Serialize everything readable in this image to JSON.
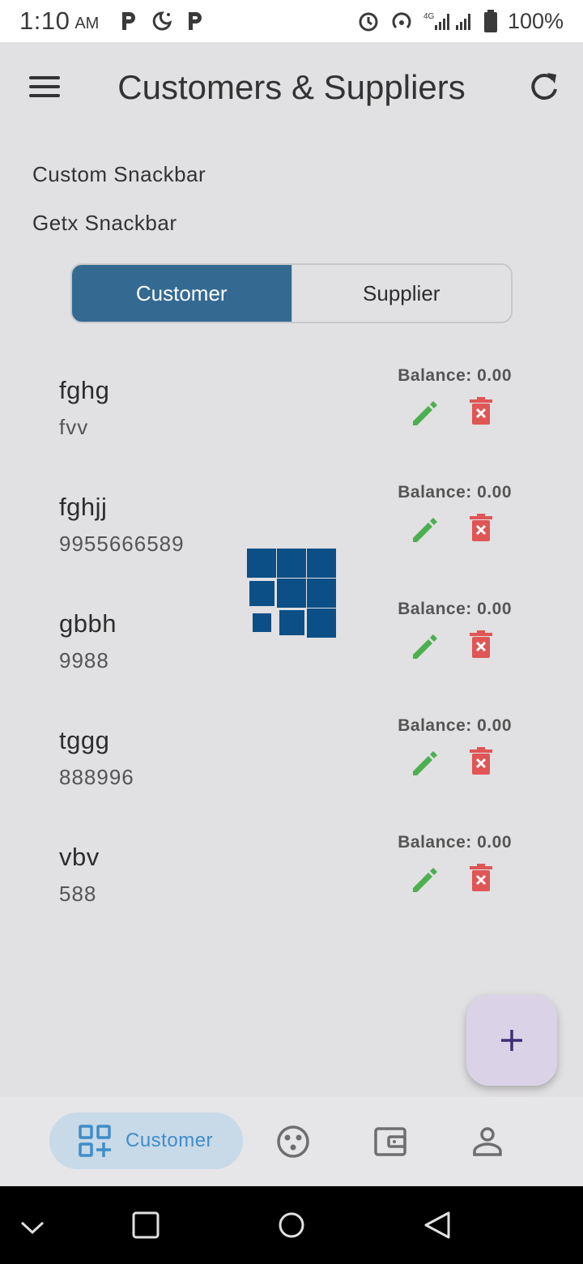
{
  "status_bar": {
    "time": "1:10",
    "ampm": "AM",
    "battery": "100%",
    "network": "4G",
    "icons": [
      "parking-icon",
      "moon-icon",
      "parking-icon",
      "alarm-icon",
      "hotspot-icon",
      "signal-icon",
      "battery-icon"
    ]
  },
  "app_bar": {
    "title": "Customers & Suppliers",
    "menu_icon": "menu-icon",
    "refresh_icon": "refresh-icon"
  },
  "links": {
    "custom_snackbar": "Custom Snackbar",
    "getx_snackbar": "Getx Snackbar"
  },
  "segments": {
    "customer": "Customer",
    "supplier": "Supplier",
    "selected": "Customer"
  },
  "customers": [
    {
      "name": "fghg",
      "sub": "fvv",
      "balance": "Balance: 0.00"
    },
    {
      "name": "fghjj",
      "sub": "9955666589",
      "balance": "Balance: 0.00"
    },
    {
      "name": "gbbh",
      "sub": "9988",
      "balance": "Balance: 0.00"
    },
    {
      "name": "tggg",
      "sub": "888996",
      "balance": "Balance: 0.00"
    },
    {
      "name": "vbv",
      "sub": "588",
      "balance": "Balance: 0.00"
    }
  ],
  "fab": {
    "icon": "plus-icon"
  },
  "bottom_nav": {
    "active_label": "Customer",
    "items": [
      "customer-icon",
      "palette-icon",
      "wallet-icon",
      "person-icon"
    ]
  },
  "colors": {
    "accent": "#346a92",
    "edit": "#4caf50",
    "delete": "#e05555",
    "fab_bg": "#dad3e8",
    "nav_pill": "#c8d9e8",
    "nav_active": "#3f8dc9"
  }
}
